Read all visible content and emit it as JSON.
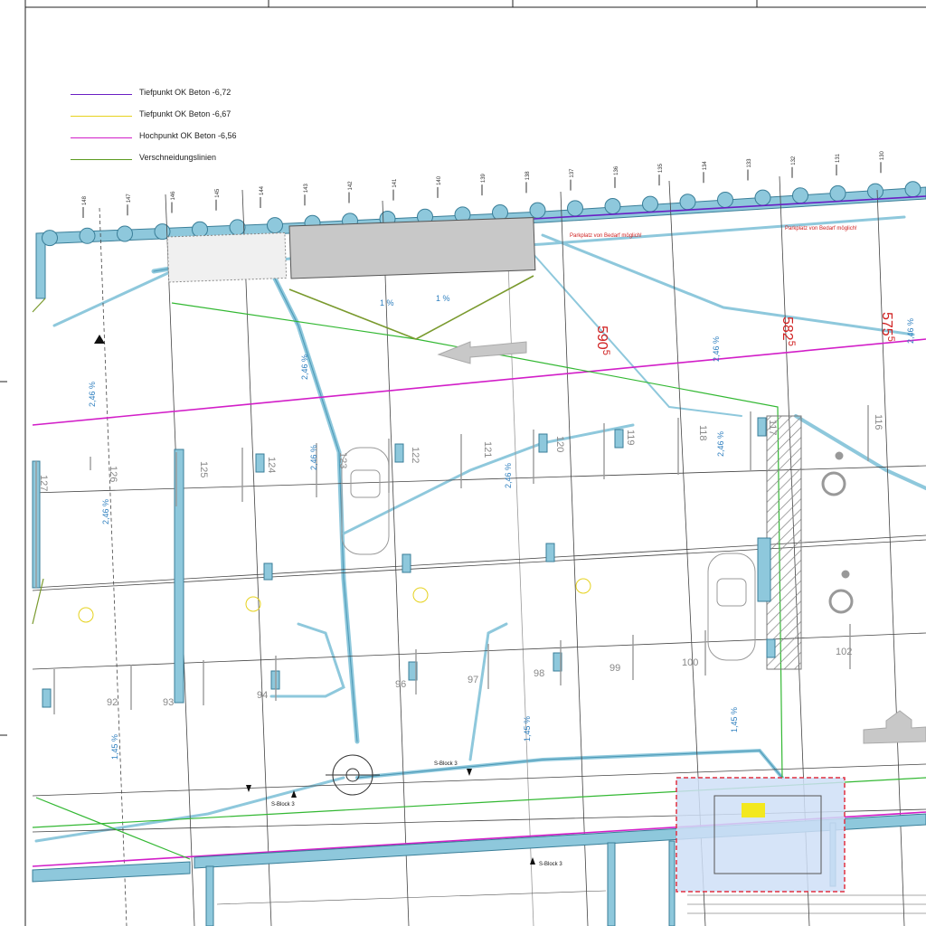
{
  "legend": [
    {
      "label": "Tiefpunkt OK Beton -6,72",
      "color": "#6a1fc4"
    },
    {
      "label": "Tiefpunkt OK Beton -6,67",
      "color": "#e6d21e"
    },
    {
      "label": "Hochpunkt OK Beton -6,56",
      "color": "#d21ec8"
    },
    {
      "label": "Verschneidungslinien",
      "color": "#5a9a1e"
    }
  ],
  "colors": {
    "line": "#333333",
    "pipe": "#8ec8dc",
    "pipe_dark": "#4a97b5",
    "slope_text": "#2e7fbf",
    "dim_red": "#d02020",
    "highpoint": "#d21ec8",
    "lowpoint": "#6a1fc4",
    "green": "#33b833",
    "hatch_blue": "#cfdff7"
  },
  "elevations": {
    "e590": "590",
    "e590_sup": "5",
    "e582": "582",
    "e582_sup": "5",
    "e575": "575",
    "e575_sup": "5"
  },
  "parking_top_row": [
    "127",
    "126",
    "125",
    "124",
    "123",
    "122",
    "121",
    "120",
    "119",
    "118",
    "117",
    "116"
  ],
  "parking_bottom_row": [
    "92",
    "93",
    "94",
    "96",
    "97",
    "98",
    "99",
    "100",
    "102"
  ],
  "slopes": [
    "2,46 %",
    "2,46 %",
    "1 %",
    "1 %",
    "2,46 %",
    "2,46 %",
    "2,46 %",
    "2,46 %",
    "1,45 %",
    "1,45 %",
    "1,45 %",
    "2,46 %",
    "2,46 %"
  ],
  "notes": {
    "parkplatz_1": "Parkplatz von Bedarf möglich!",
    "parkplatz_2": "Parkplatz von Bedarf möglich!"
  },
  "section_marks": [
    "S-Block 3",
    "S-Block 3",
    "S-Block 3"
  ],
  "grid_axes": [
    "148",
    "147",
    "146",
    "145",
    "144",
    "143",
    "142",
    "141",
    "140",
    "139",
    "138",
    "137",
    "136",
    "135",
    "134",
    "133",
    "132",
    "131",
    "130"
  ]
}
